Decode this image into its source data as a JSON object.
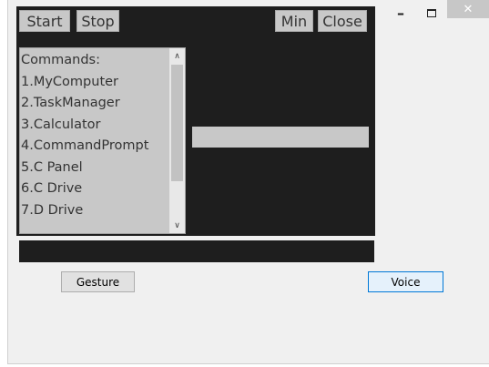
{
  "window": {
    "minimize_glyph": "–",
    "close_glyph": "✕"
  },
  "toolbar": {
    "start_label": "Start",
    "stop_label": "Stop",
    "min_label": "Min",
    "close_label": "Close"
  },
  "commands": {
    "items": [
      "Commands:",
      "1.MyComputer",
      "2.TaskManager",
      "3.Calculator",
      "4.CommandPrompt",
      "5.C Panel",
      "6.C Drive",
      "7.D Drive"
    ],
    "scroll_up_glyph": "∧",
    "scroll_down_glyph": "∨"
  },
  "buttons": {
    "gesture_label": "Gesture",
    "voice_label": "Voice"
  },
  "colors": {
    "dark_panel": "#1e1e1e",
    "control_gray": "#c8c8c8",
    "focus_border": "#0078d7"
  }
}
